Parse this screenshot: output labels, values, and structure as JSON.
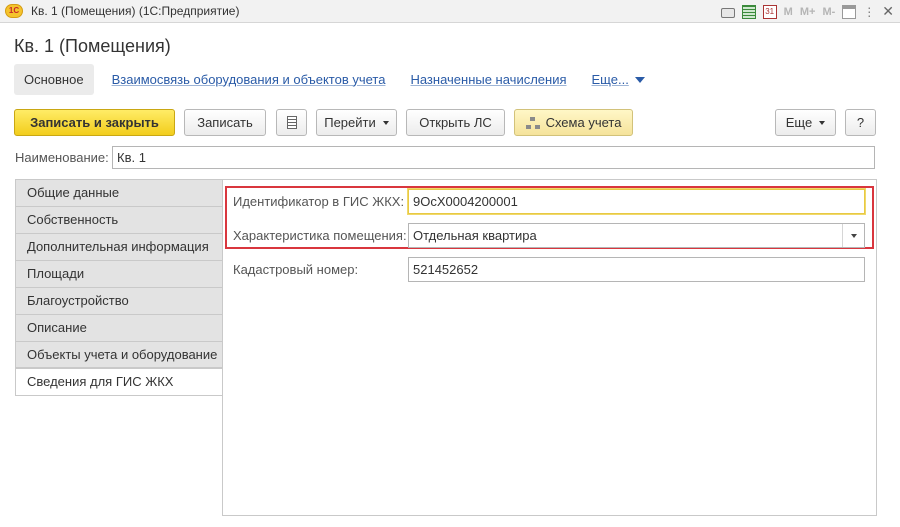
{
  "window": {
    "logo": "1С",
    "title": "Кв. 1 (Помещения)  (1С:Предприятие)",
    "icons": [
      "print-icon",
      "calculator-icon",
      "calendar-icon",
      "memory-icon",
      "window-icon",
      "more-icon",
      "close-icon"
    ],
    "memory_labels": [
      "M",
      "M+",
      "M-"
    ],
    "calendar_day": "31"
  },
  "document": {
    "title": "Кв. 1 (Помещения)"
  },
  "nav": {
    "active": "Основное",
    "links": [
      "Взаимосвязь оборудования и объектов учета",
      "Назначенные начисления"
    ],
    "more": "Еще..."
  },
  "toolbar": {
    "save_close": "Записать и закрыть",
    "save": "Записать",
    "goto": "Перейти",
    "open_ls": "Открыть ЛС",
    "schema": "Схема учета",
    "more": "Еще",
    "help": "?"
  },
  "name_field": {
    "label": "Наименование:",
    "value": "Кв. 1"
  },
  "side_tabs": [
    "Общие данные",
    "Собственность",
    "Дополнительная информация",
    "Площади",
    "Благоустройство",
    "Описание",
    "Объекты учета и оборудование",
    "Сведения для ГИС ЖКХ"
  ],
  "active_tab_index": 7,
  "fields": {
    "gis_id": {
      "label": "Идентификатор в ГИС ЖКХ:",
      "value": "9OcX0004200001"
    },
    "characteristic": {
      "label": "Характеристика помещения:",
      "value": "Отдельная квартира"
    },
    "cadastral": {
      "label": "Кадастровый номер:",
      "value": "521452652"
    }
  },
  "colors": {
    "highlight": "#d9363e",
    "primary_button": "#f5d324",
    "link": "#2a5ba7"
  }
}
